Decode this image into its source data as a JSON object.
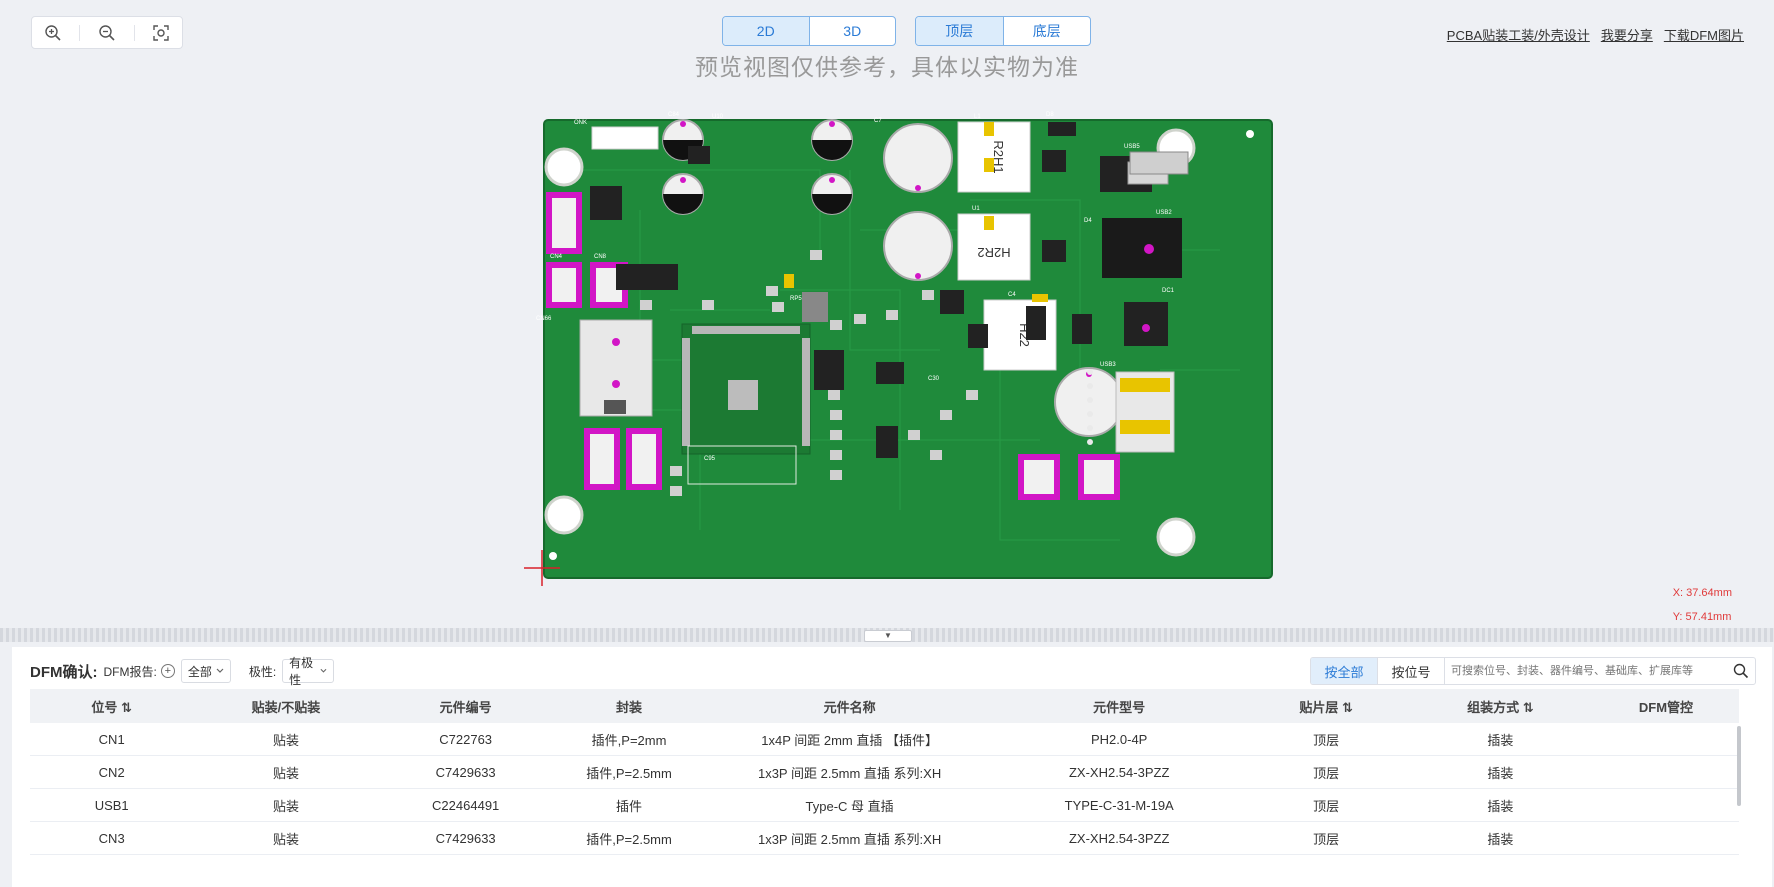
{
  "view_toggle": {
    "btn_2d": "2D",
    "btn_3d": "3D"
  },
  "layer_toggle": {
    "top": "顶层",
    "bottom": "底层"
  },
  "notice": "预览视图仅供参考，具体以实物为准",
  "links": {
    "design": "PCBA贴装工装/外壳设计",
    "share": "我要分享",
    "download": "下载DFM图片"
  },
  "coords": {
    "x": "X:  37.64mm",
    "y": "Y:  57.41mm"
  },
  "toolbar": {
    "title": "DFM确认:",
    "report_label": "DFM报告:",
    "report_value": "全部",
    "polarity_label": "极性:",
    "polarity_value": "有极性"
  },
  "search": {
    "tab_all": "按全部",
    "tab_ref": "按位号",
    "placeholder": "可搜索位号、封装、器件编号、基础库、扩展库等"
  },
  "table": {
    "headers": [
      "位号 ⇅",
      "贴装/不贴装",
      "元件编号",
      "封装",
      "元件名称",
      "元件型号",
      "贴片层 ⇅",
      "组装方式 ⇅",
      "DFM管控"
    ],
    "rows": [
      [
        "CN1",
        "贴装",
        "C722763",
        "插件,P=2mm",
        "1x4P 间距 2mm 直插 【插件】",
        "PH2.0-4P",
        "顶层",
        "插装",
        ""
      ],
      [
        "CN2",
        "贴装",
        "C7429633",
        "插件,P=2.5mm",
        "1x3P 间距 2.5mm 直插 系列:XH",
        "ZX-XH2.54-3PZZ",
        "顶层",
        "插装",
        ""
      ],
      [
        "USB1",
        "贴装",
        "C22464491",
        "插件",
        "Type-C 母 直插",
        "TYPE-C-31-M-19A",
        "顶层",
        "插装",
        ""
      ],
      [
        "CN3",
        "贴装",
        "C7429633",
        "插件,P=2.5mm",
        "1x3P 间距 2.5mm 直插 系列:XH",
        "ZX-XH2.54-3PZZ",
        "顶层",
        "插装",
        ""
      ]
    ]
  },
  "pcb_labels": {
    "lbl_onk": "ONK",
    "lbl_c84": "C84",
    "lbl_u10": "U10",
    "lbl_c7": "C7",
    "lbl_l1": "L1",
    "lbl_d8": "D8",
    "lbl_usb5": "USB5",
    "lbl_u1": "U1",
    "lbl_usb2": "USB2",
    "lbl_dc1": "DC1",
    "lbl_cn4": "CN4",
    "lbl_cn8": "CN8",
    "lbl_cn66": "CN66",
    "lbl_usb3": "USB3",
    "lbl_c30": "C30",
    "lbl_c95": "C95",
    "lbl_rp5": "RP5",
    "lbl_d4": "D4",
    "lbl_c4": "C4",
    "ind1": "R2H1",
    "ind2": "H2R2",
    "ind3": "H22"
  },
  "colors": {
    "pcb": "#1e8a3a",
    "accent": "#2b7bd6",
    "coord": "#e03a3a"
  }
}
